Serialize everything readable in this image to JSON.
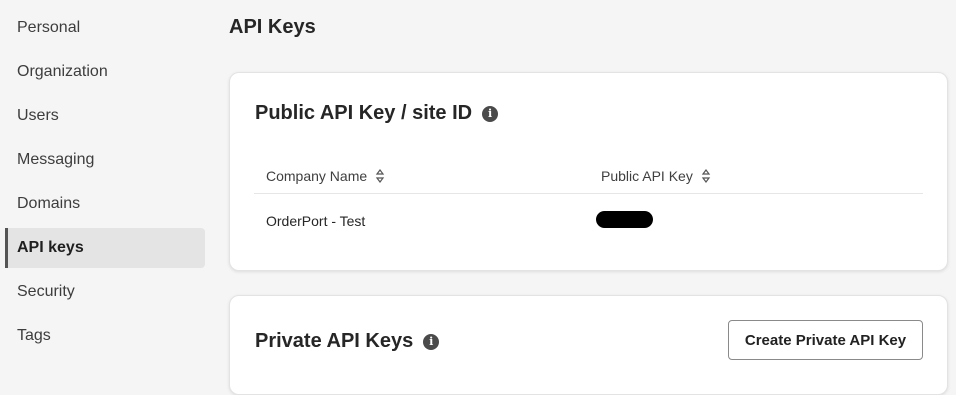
{
  "sidebar": {
    "items": [
      {
        "label": "Personal"
      },
      {
        "label": "Organization"
      },
      {
        "label": "Users"
      },
      {
        "label": "Messaging"
      },
      {
        "label": "Domains"
      },
      {
        "label": "API keys",
        "active": true
      },
      {
        "label": "Security"
      },
      {
        "label": "Tags"
      }
    ]
  },
  "page": {
    "title": "API Keys"
  },
  "public_card": {
    "title": "Public API Key / site ID",
    "info_icon": "info-icon",
    "columns": [
      "Company Name",
      "Public API Key"
    ],
    "rows": [
      {
        "company": "OrderPort - Test",
        "key_masked": true
      }
    ]
  },
  "private_card": {
    "title": "Private API Keys",
    "info_icon": "info-icon",
    "create_button": "Create Private API Key"
  },
  "colors": {
    "background": "#f5f5f5",
    "card": "#ffffff",
    "active_nav": "#e4e4e4",
    "active_indicator": "#555555"
  }
}
